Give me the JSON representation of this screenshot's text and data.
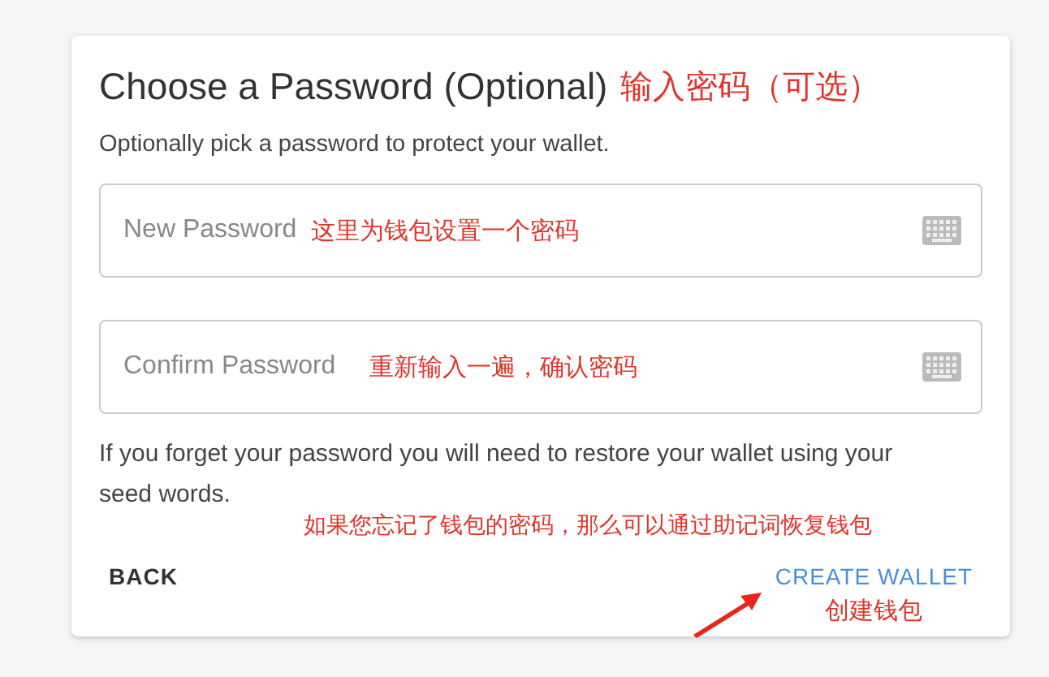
{
  "title": "Choose a Password (Optional)",
  "title_note": "输入密码（可选）",
  "subtitle": "Optionally pick a password to protect your wallet.",
  "fields": [
    {
      "placeholder": "New Password",
      "note": "这里为钱包设置一个密码"
    },
    {
      "placeholder": "Confirm Password",
      "note": "重新输入一遍，确认密码"
    }
  ],
  "hint": "If you forget your password you will need to restore your wallet using your seed words.",
  "hint_note": "如果您忘记了钱包的密码，那么可以通过助记词恢复钱包",
  "buttons": [
    {
      "label": "BACK",
      "kind": "text"
    },
    {
      "label": "CREATE WALLET",
      "kind": "primary",
      "note": "创建钱包"
    }
  ]
}
